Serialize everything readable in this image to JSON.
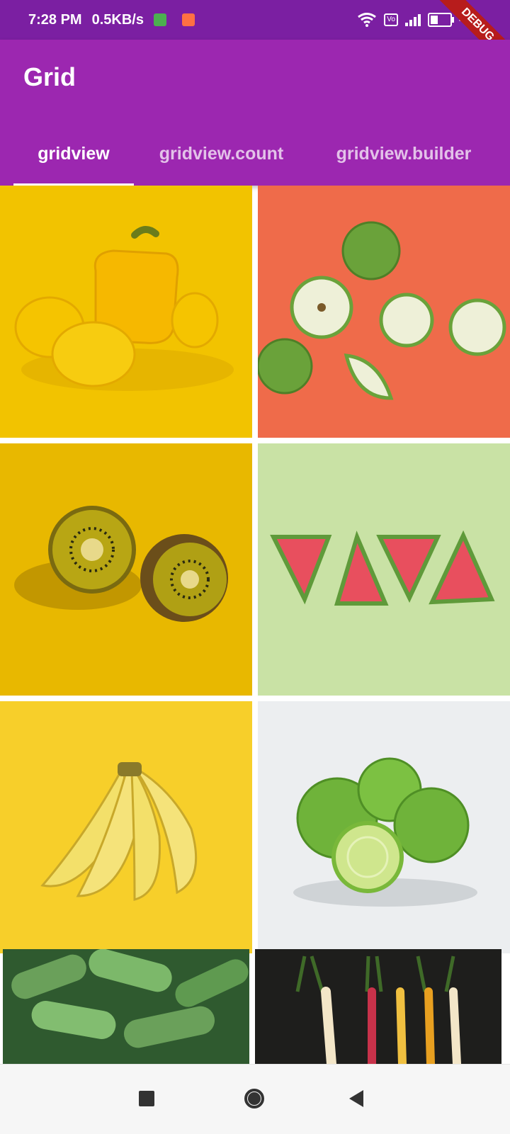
{
  "status_bar": {
    "time": "7:28 PM",
    "net_speed": "0.5KB/s",
    "battery": "47%",
    "debug_label": "DEBUG",
    "icons": [
      "robot-icon",
      "video-icon",
      "wifi-icon",
      "volte-icon",
      "signal-icon",
      "battery-icon"
    ]
  },
  "app_bar": {
    "title": "Grid",
    "color": "#9c27b0"
  },
  "tabs": [
    {
      "label": "gridview",
      "selected": true
    },
    {
      "label": "gridview.count",
      "selected": false
    },
    {
      "label": "gridview.builder",
      "selected": false
    }
  ],
  "grid": {
    "tiles": [
      {
        "name": "yellow-pepper-lemons",
        "bg": "#f2c300"
      },
      {
        "name": "green-apples",
        "bg": "#ef6b4a"
      },
      {
        "name": "kiwi",
        "bg": "#e8b800"
      },
      {
        "name": "watermelon-slices",
        "bg": "#c9e2a5"
      },
      {
        "name": "bananas",
        "bg": "#f7cf2a"
      },
      {
        "name": "limes",
        "bg": "#eceef0"
      },
      {
        "name": "cucumbers",
        "bg": "#2f5a2f"
      },
      {
        "name": "carrots",
        "bg": "#1e1e1c"
      }
    ]
  },
  "nav_bar": {
    "icons": [
      "recents-square-icon",
      "home-circle-icon",
      "back-triangle-icon"
    ]
  }
}
